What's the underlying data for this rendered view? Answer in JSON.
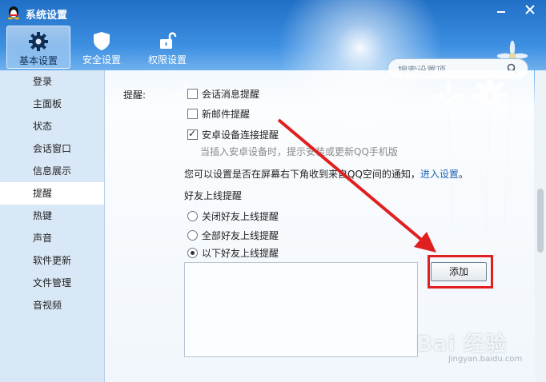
{
  "window": {
    "title": "系统设置"
  },
  "toolbar": {
    "tabs": [
      {
        "label": "基本设置",
        "icon": "gear-icon",
        "active": true
      },
      {
        "label": "安全设置",
        "icon": "shield-icon",
        "active": false
      },
      {
        "label": "权限设置",
        "icon": "lock-icon",
        "active": false
      }
    ],
    "search_placeholder": "搜索设置项"
  },
  "sidebar": {
    "items": [
      {
        "label": "登录"
      },
      {
        "label": "主面板"
      },
      {
        "label": "状态"
      },
      {
        "label": "会话窗口"
      },
      {
        "label": "信息展示"
      },
      {
        "label": "提醒",
        "active": true
      },
      {
        "label": "热键"
      },
      {
        "label": "声音"
      },
      {
        "label": "软件更新"
      },
      {
        "label": "文件管理"
      },
      {
        "label": "音视频"
      }
    ]
  },
  "main": {
    "remind_label": "提醒:",
    "checkboxes": [
      {
        "label": "会话消息提醒",
        "checked": false
      },
      {
        "label": "新邮件提醒",
        "checked": false
      },
      {
        "label": "安卓设备连接提醒",
        "checked": true
      }
    ],
    "android_hint": "当插入安卓设备时，提示安装或更新QQ手机版",
    "qzone_text": "您可以设置是否在屏幕右下角收到来自QQ空间的通知，",
    "qzone_link": "进入设置",
    "qzone_end": "。",
    "friend_section": "好友上线提醒",
    "radios": [
      {
        "label": "关闭好友上线提醒",
        "selected": false
      },
      {
        "label": "全部好友上线提醒",
        "selected": false
      },
      {
        "label": "以下好友上线提醒",
        "selected": true
      }
    ],
    "add_button": "添加"
  },
  "watermark": {
    "text": "Bai 经验",
    "sub": "jingyan.baidu.com"
  },
  "colors": {
    "accent": "#1f6fc6",
    "highlight": "#e02020",
    "link": "#1f63b5"
  }
}
